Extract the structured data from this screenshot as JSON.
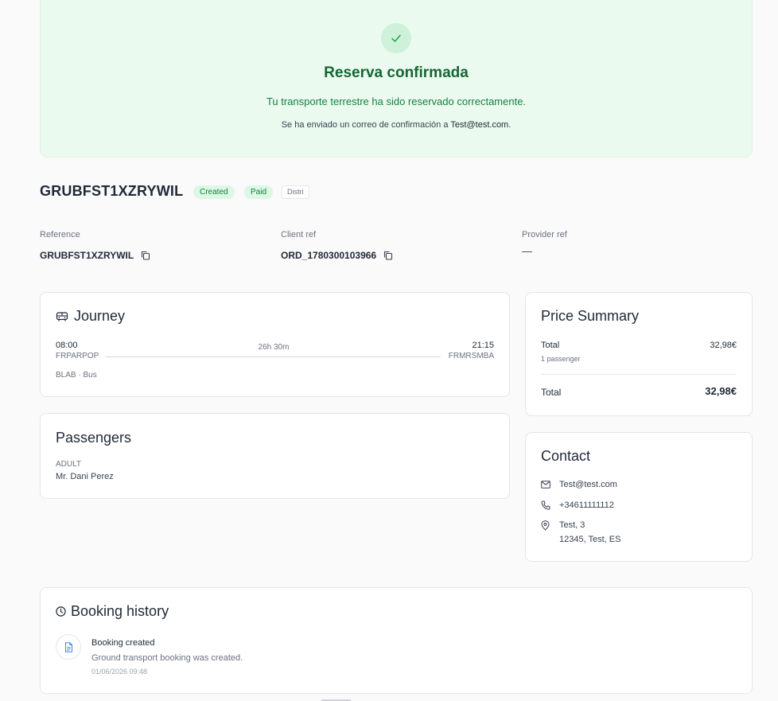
{
  "banner": {
    "title": "Reserva confirmada",
    "subtitle": "Tu transporte terrestre ha sido reservado correctamente.",
    "mail_prefix": "Se ha enviado un correo de confirmación a ",
    "mail_address": "Test@test.com",
    "mail_suffix": "."
  },
  "booking": {
    "code": "GRUBFST1XZRYWIL",
    "badges": [
      "Created",
      "Paid",
      "Distri"
    ]
  },
  "fields": {
    "reference_label": "Reference",
    "reference_value": "GRUBFST1XZRYWIL",
    "client_ref_label": "Client ref",
    "client_ref_value": "ORD_1780300103966",
    "provider_ref_label": "Provider ref",
    "provider_ref_value": "—"
  },
  "journey": {
    "title": "Journey",
    "departure_time": "08:00",
    "departure_code": "FRPARPOP",
    "duration": "26h 30m",
    "arrival_time": "21:15",
    "arrival_code": "FRMRSMBA",
    "provider": "BLAB · Bus"
  },
  "passengers": {
    "title": "Passengers",
    "type": "ADULT",
    "name": "Mr. Dani Perez"
  },
  "price": {
    "title": "Price Summary",
    "row_label": "Total",
    "row_sub": "1 passenger",
    "row_value": "32,98€",
    "total_label": "Total",
    "total_value": "32,98€"
  },
  "contact": {
    "title": "Contact",
    "email": "Test@test.com",
    "phone": "+34611111112",
    "address_line1": "Test, 3",
    "address_line2": "12345, Test, ES"
  },
  "history": {
    "title": "Booking history",
    "event_title": "Booking created",
    "event_desc": "Ground transport booking was created.",
    "event_date": "01/06/2026 09:48"
  },
  "colors": {
    "success_bg": "#ebfaef",
    "success_text": "#166534",
    "badge_bg": "#dcf7e4"
  }
}
